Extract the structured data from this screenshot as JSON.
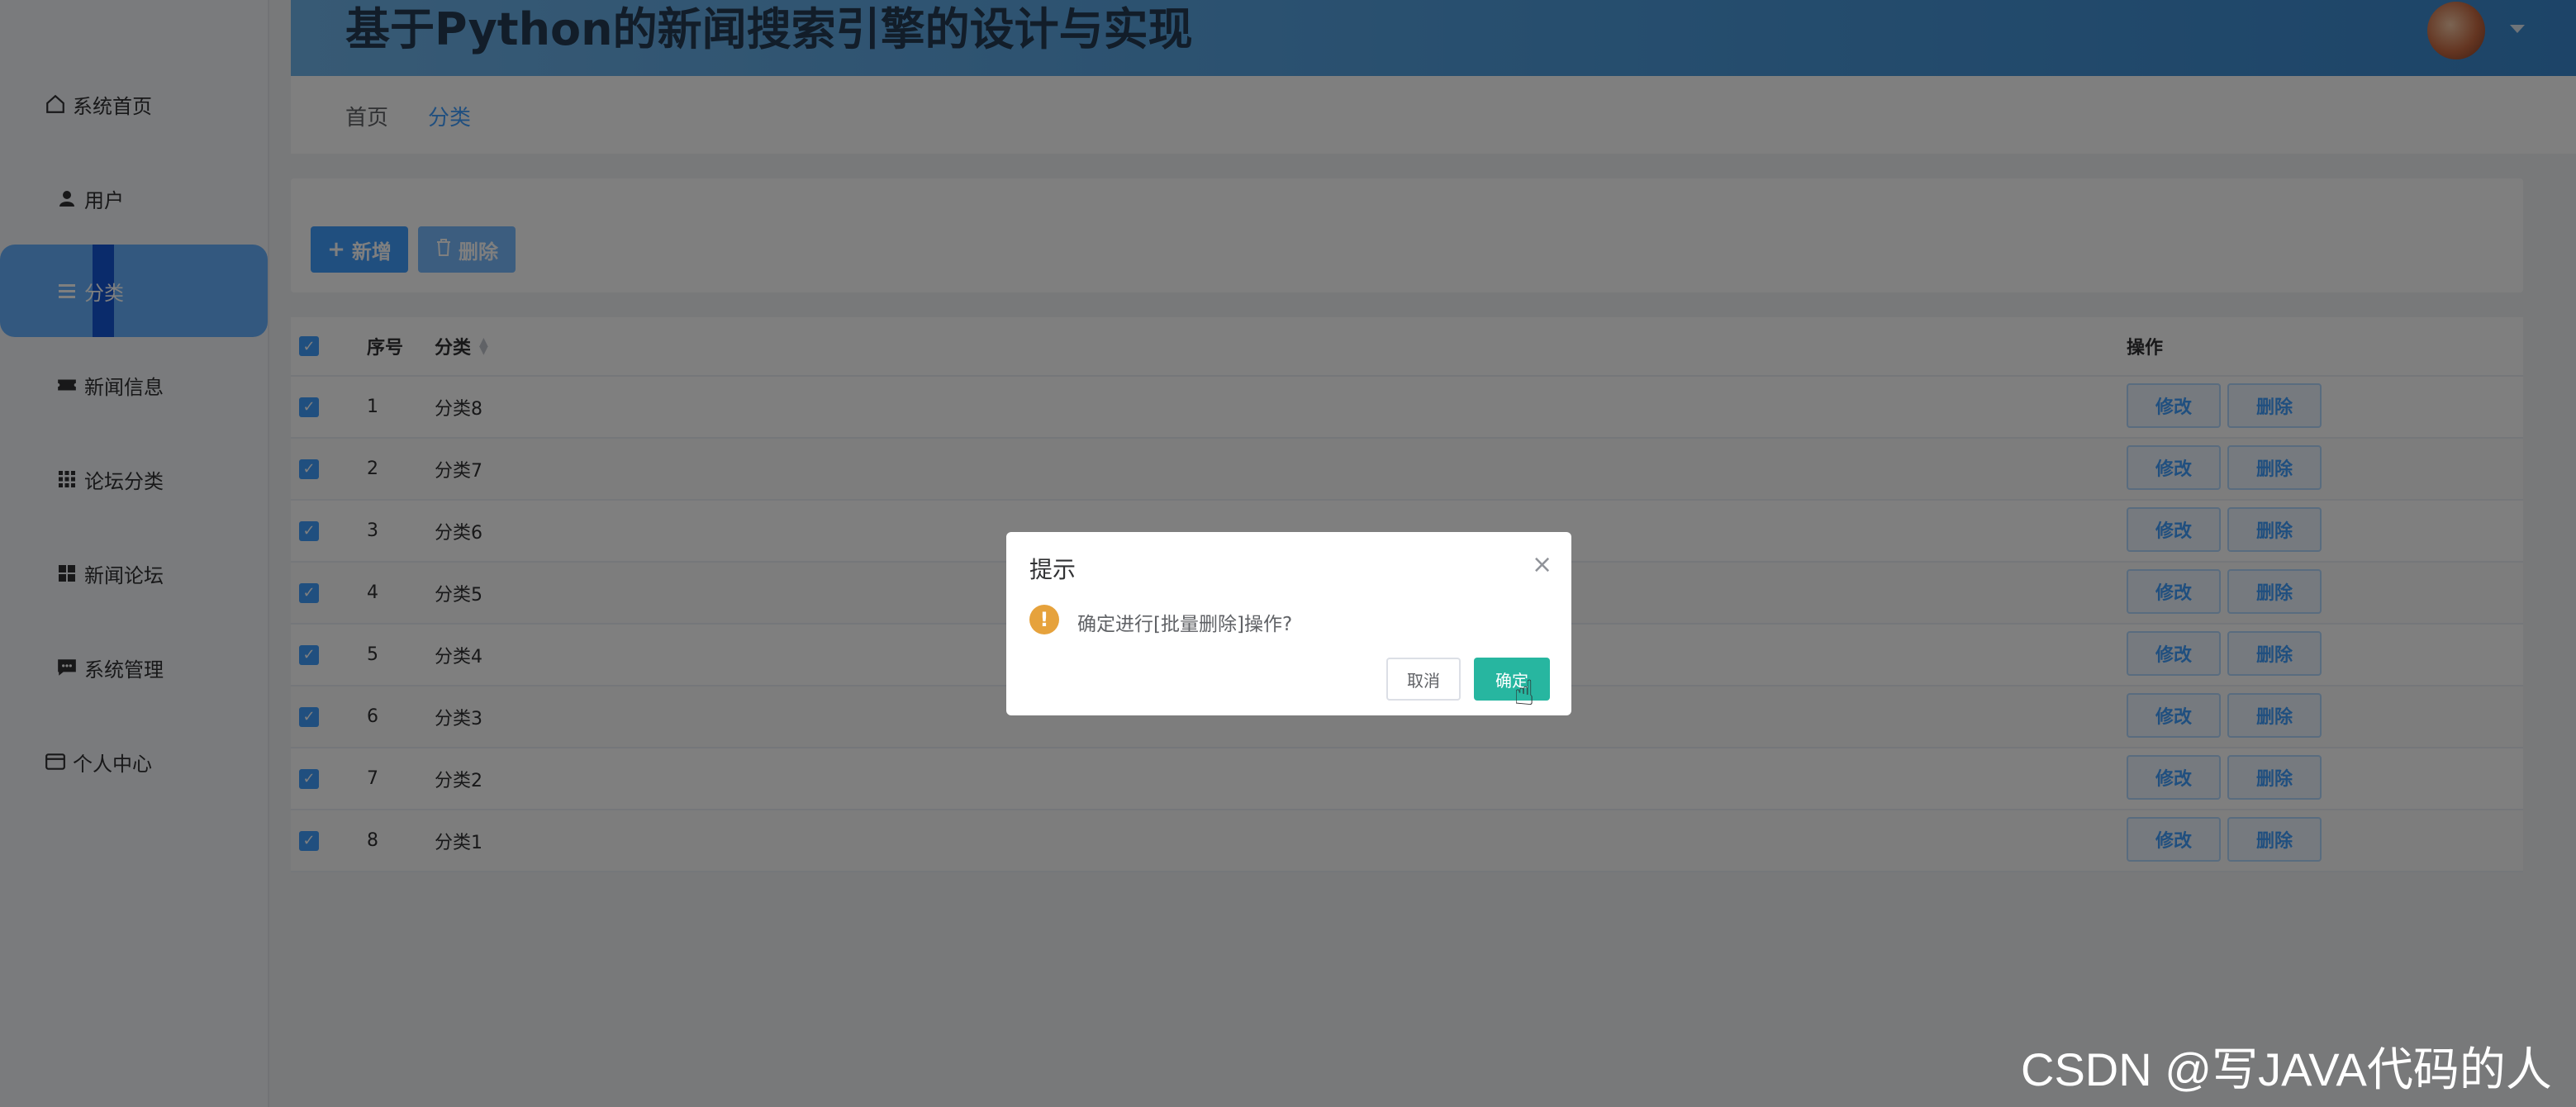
{
  "app": {
    "title": "基于Python的新闻搜索引擎的设计与实现"
  },
  "sidebar": {
    "items": [
      {
        "label": "系统首页",
        "icon": "home-icon"
      },
      {
        "label": "用户",
        "icon": "user-icon"
      },
      {
        "label": "分类",
        "icon": "menu-icon",
        "active": true
      },
      {
        "label": "新闻信息",
        "icon": "ticket-icon"
      },
      {
        "label": "论坛分类",
        "icon": "grid-icon"
      },
      {
        "label": "新闻论坛",
        "icon": "apps-icon"
      },
      {
        "label": "系统管理",
        "icon": "message-icon"
      },
      {
        "label": "个人中心",
        "icon": "wallet-icon"
      }
    ]
  },
  "breadcrumb": {
    "home": "首页",
    "current": "分类"
  },
  "toolbar": {
    "add_label": "新增",
    "delete_label": "删除"
  },
  "table": {
    "headers": {
      "index": "序号",
      "category": "分类",
      "actions": "操作"
    },
    "edit_label": "修改",
    "delete_label": "删除",
    "rows": [
      {
        "index": "1",
        "category": "分类8"
      },
      {
        "index": "2",
        "category": "分类7"
      },
      {
        "index": "3",
        "category": "分类6"
      },
      {
        "index": "4",
        "category": "分类5"
      },
      {
        "index": "5",
        "category": "分类4"
      },
      {
        "index": "6",
        "category": "分类3"
      },
      {
        "index": "7",
        "category": "分类2"
      },
      {
        "index": "8",
        "category": "分类1"
      }
    ]
  },
  "dialog": {
    "title": "提示",
    "message": "确定进行[批量删除]操作?",
    "cancel_label": "取消",
    "confirm_label": "确定"
  },
  "watermark": "CSDN @写JAVA代码的人",
  "colors": {
    "primary": "#409eff",
    "confirm": "#27b6a0",
    "warning": "#e6a23c"
  }
}
